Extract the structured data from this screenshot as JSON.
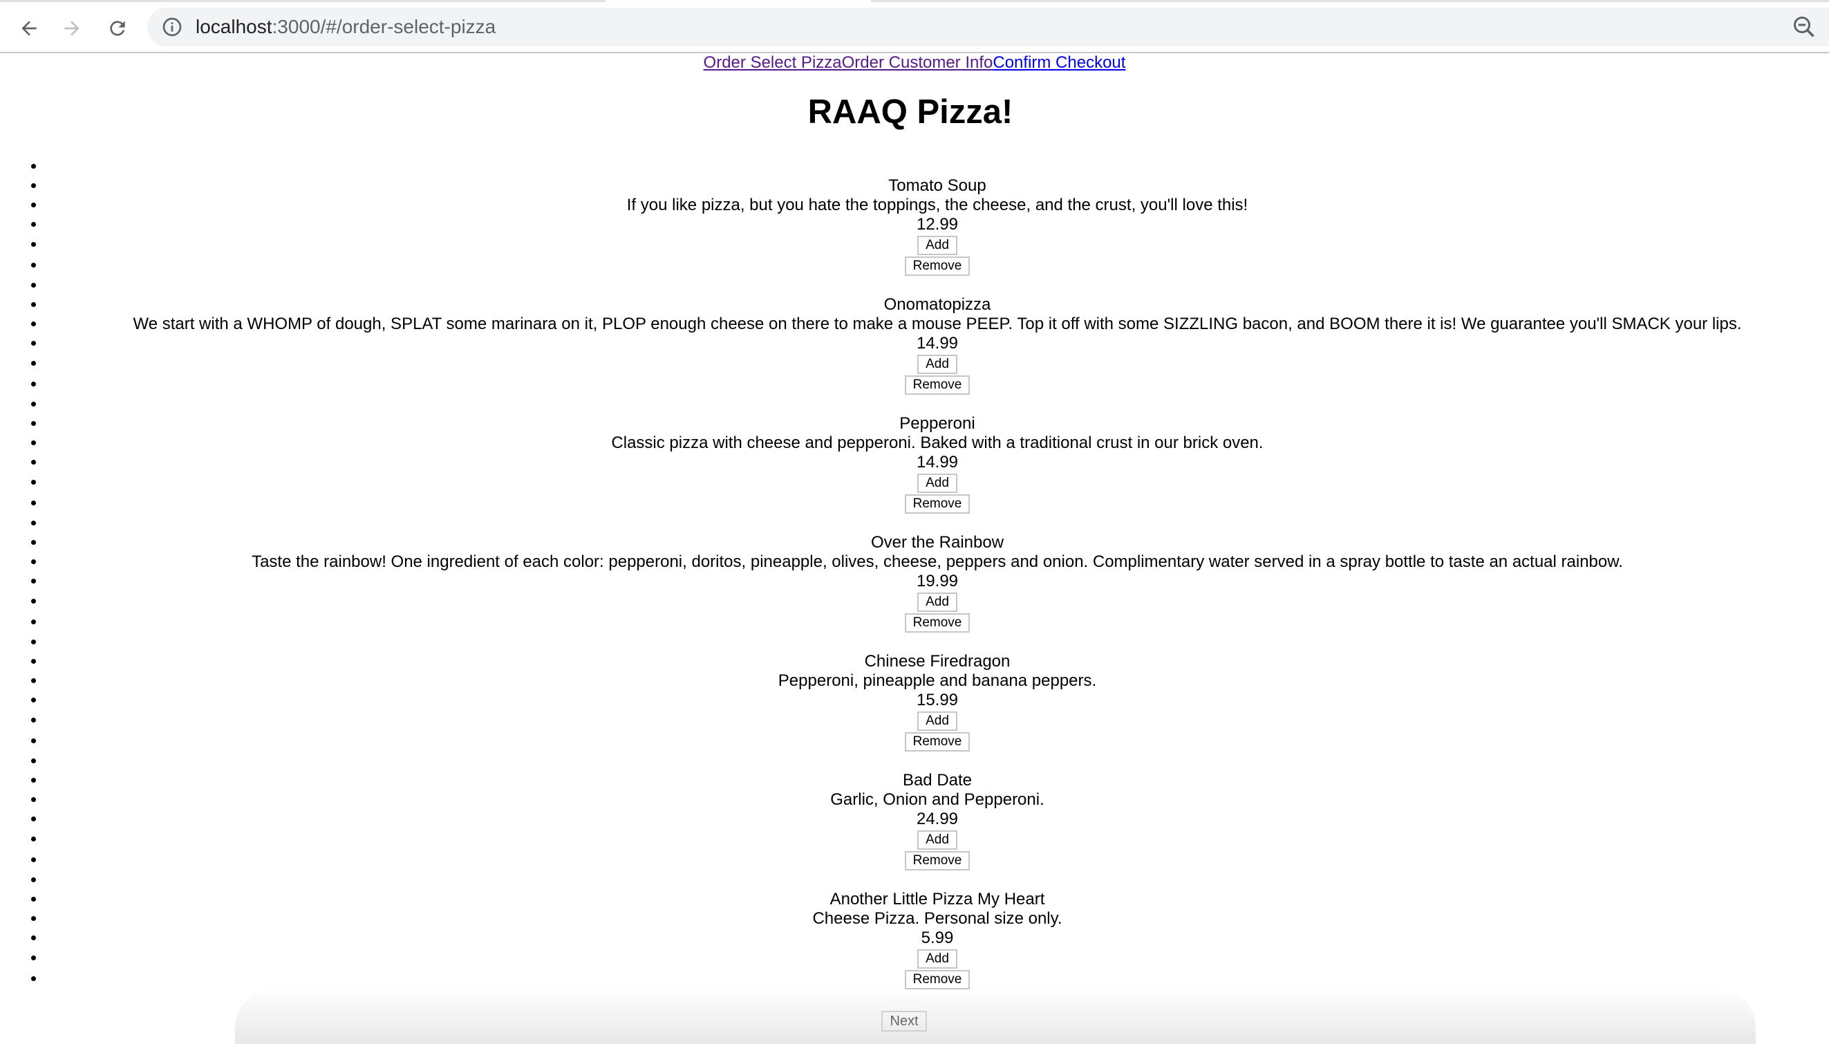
{
  "browser": {
    "url_host": "localhost",
    "url_path": ":3000/#/order-select-pizza",
    "icons": {
      "back": "arrow-left-icon",
      "forward": "arrow-right-icon",
      "reload": "reload-icon",
      "site_info": "info-icon",
      "zoom": "zoom-out-icon"
    }
  },
  "nav": {
    "links": [
      {
        "label": "Order Select Pizza",
        "state": "visited"
      },
      {
        "label": "Order Customer Info",
        "state": "visited"
      },
      {
        "label": "Confirm Checkout",
        "state": "unvisited"
      }
    ],
    "colors": {
      "visited": "#551a8b",
      "unvisited": "#0000ee"
    }
  },
  "page_title": "RAAQ Pizza!",
  "pizzas": [
    {
      "name": "Tomato Soup",
      "description": "If you like pizza, but you hate the toppings, the cheese, and the crust, you'll love this!",
      "price": "12.99"
    },
    {
      "name": "Onomatopizza",
      "description": "We start with a WHOMP of dough, SPLAT some marinara on it, PLOP enough cheese on there to make a mouse PEEP. Top it off with some SIZZLING bacon, and BOOM there it is! We guarantee you'll SMACK your lips.",
      "price": "14.99"
    },
    {
      "name": "Pepperoni",
      "description": "Classic pizza with cheese and pepperoni. Baked with a traditional crust in our brick oven.",
      "price": "14.99"
    },
    {
      "name": "Over the Rainbow",
      "description": "Taste the rainbow! One ingredient of each color: pepperoni, doritos, pineapple, olives, cheese, peppers and onion. Complimentary water served in a spray bottle to taste an actual rainbow.",
      "price": "19.99"
    },
    {
      "name": "Chinese Firedragon",
      "description": "Pepperoni, pineapple and banana peppers.",
      "price": "15.99"
    },
    {
      "name": "Bad Date",
      "description": "Garlic, Onion and Pepperoni.",
      "price": "24.99"
    },
    {
      "name": "Another Little Pizza My Heart",
      "description": "Cheese Pizza. Personal size only.",
      "price": "5.99"
    }
  ],
  "buttons": {
    "add": "Add",
    "remove": "Remove",
    "next": "Next"
  }
}
